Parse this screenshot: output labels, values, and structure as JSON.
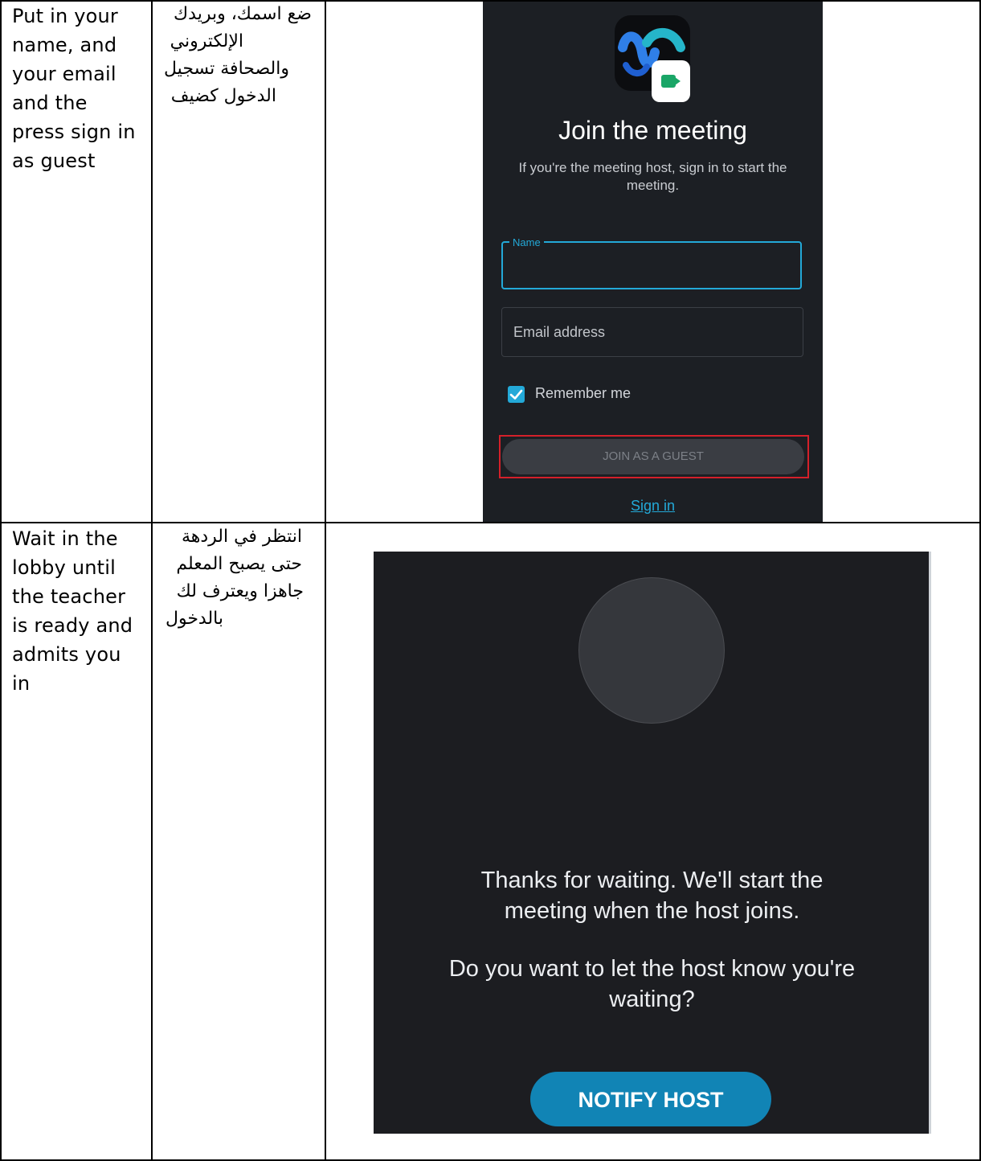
{
  "rows": [
    {
      "english": [
        "Put in your",
        "name, and",
        "your email",
        "and the",
        "press sign in",
        "as guest"
      ],
      "arabic": [
        "ضع اسمك، وبريدك",
        "الإلكتروني",
        "والصحافة تسجيل",
        "الدخول كضيف"
      ]
    },
    {
      "english": [
        "Wait in the",
        "lobby until",
        "the teacher",
        "is ready and",
        "admits you",
        "in"
      ],
      "arabic": [
        "انتظر في الردهة",
        "حتى يصبح المعلم",
        "جاهزا ويعترف لك",
        "بالدخول"
      ]
    }
  ],
  "join_screen": {
    "title": "Join the meeting",
    "subtitle_line1": "If you're the meeting host, sign in to start the",
    "subtitle_line2": "meeting.",
    "name_label": "Name",
    "name_value": "",
    "email_placeholder": "Email address",
    "remember_label": "Remember me",
    "remember_checked": true,
    "guest_button": "JOIN AS A GUEST",
    "signin_link": "Sign in",
    "logo_icon": "webex-app-icon",
    "colors": {
      "accent": "#23a9d8",
      "highlight": "#d4202a",
      "background": "#1c1f24"
    }
  },
  "waiting_screen": {
    "message1_line1": "Thanks for waiting. We'll start the",
    "message1_line2": "meeting when the host joins.",
    "message2_line1": "Do you want to let the host know you're",
    "message2_line2": "waiting?",
    "notify_button": "NOTIFY HOST",
    "colors": {
      "button": "#1184b5",
      "background": "#1c1d21"
    }
  }
}
